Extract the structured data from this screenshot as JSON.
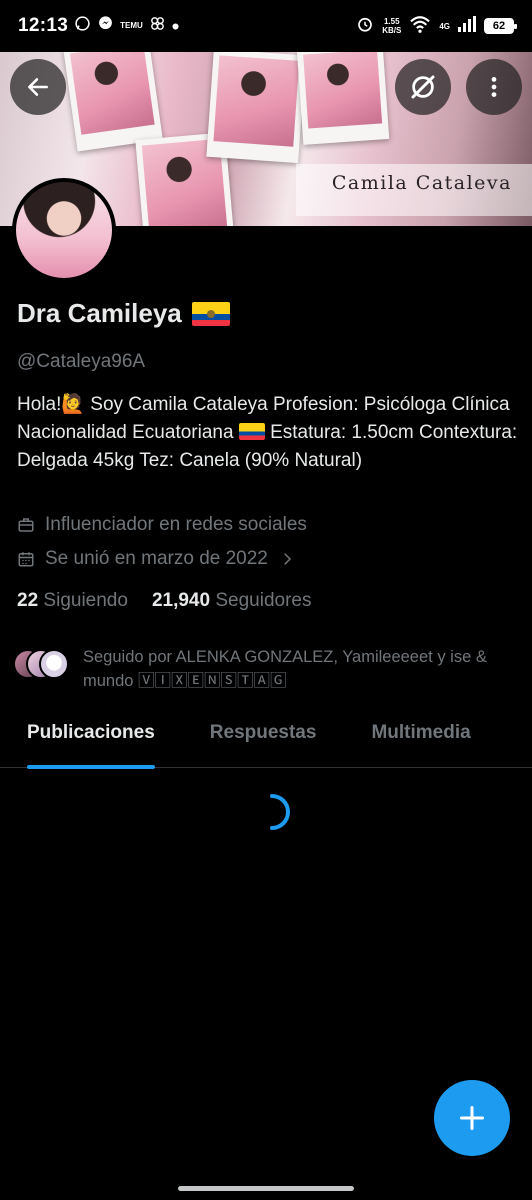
{
  "status_bar": {
    "time": "12:13",
    "temu_label": "TEMU",
    "net_speed_value": "1.55",
    "net_speed_unit": "KB/S",
    "network": "4G",
    "battery": "62"
  },
  "banner": {
    "title": "Camila Cataleva"
  },
  "profile": {
    "name": "Dra Camileya",
    "handle": "@Cataleya96A",
    "bio_part1": "Hola!🙋 Soy Camila Cataleya  Profesion: Psicóloga Clínica  Nacionalidad Ecuatoriana ",
    "bio_part2": " Estatura: 1.50cm Contextura: Delgada 45kg Tez: Canela (90% Natural)",
    "category": "Influenciador en redes sociales",
    "joined": "Se unió en marzo de 2022",
    "following_count": "22",
    "following_label": "Siguiendo",
    "followers_count": "21,940",
    "followers_label": "Seguidores",
    "followed_by": "Seguido por ALENKA GONZALEZ, Yamileeeeet y ise & mundo 🅅🄸🅇🄴🄽🅂🅃🄰🄶"
  },
  "tabs": [
    {
      "label": "Publicaciones"
    },
    {
      "label": "Respuestas"
    },
    {
      "label": "Multimedia"
    }
  ],
  "colors": {
    "accent": "#1d9bf0",
    "background": "#000000",
    "secondary_text": "#71767b"
  }
}
